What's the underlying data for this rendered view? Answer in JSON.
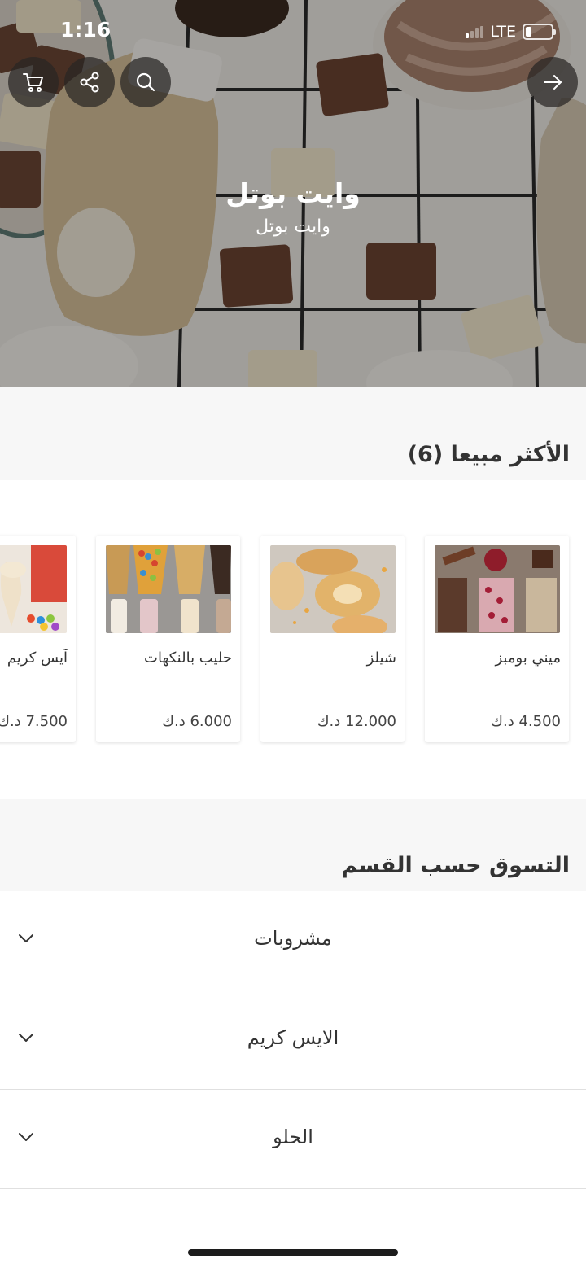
{
  "status_bar": {
    "time": "1:16",
    "network": "LTE"
  },
  "hero": {
    "title": "وايت بوتل",
    "subtitle": "وايت بوتل",
    "icons": [
      "cart-icon",
      "share-icon",
      "search-icon",
      "arrow-right-icon"
    ]
  },
  "best_sellers": {
    "heading": "الأكثر مبيعا (6)",
    "products": [
      {
        "name": "ميني بومبز",
        "price": "4.500 د.ك"
      },
      {
        "name": "شيلز",
        "price": "12.000 د.ك"
      },
      {
        "name": "حليب بالنكهات",
        "price": "6.000 د.ك"
      },
      {
        "name": "آيس كريم",
        "price": "7.500 د.ك"
      }
    ]
  },
  "shop_by_category": {
    "heading": "التسوق حسب القسم",
    "categories": [
      {
        "label": "مشروبات"
      },
      {
        "label": "الايس كريم"
      },
      {
        "label": "الحلو"
      }
    ]
  },
  "colors": {
    "section_bg": "#f7f7f7",
    "text": "#333333",
    "divider": "#e0e0e0"
  }
}
